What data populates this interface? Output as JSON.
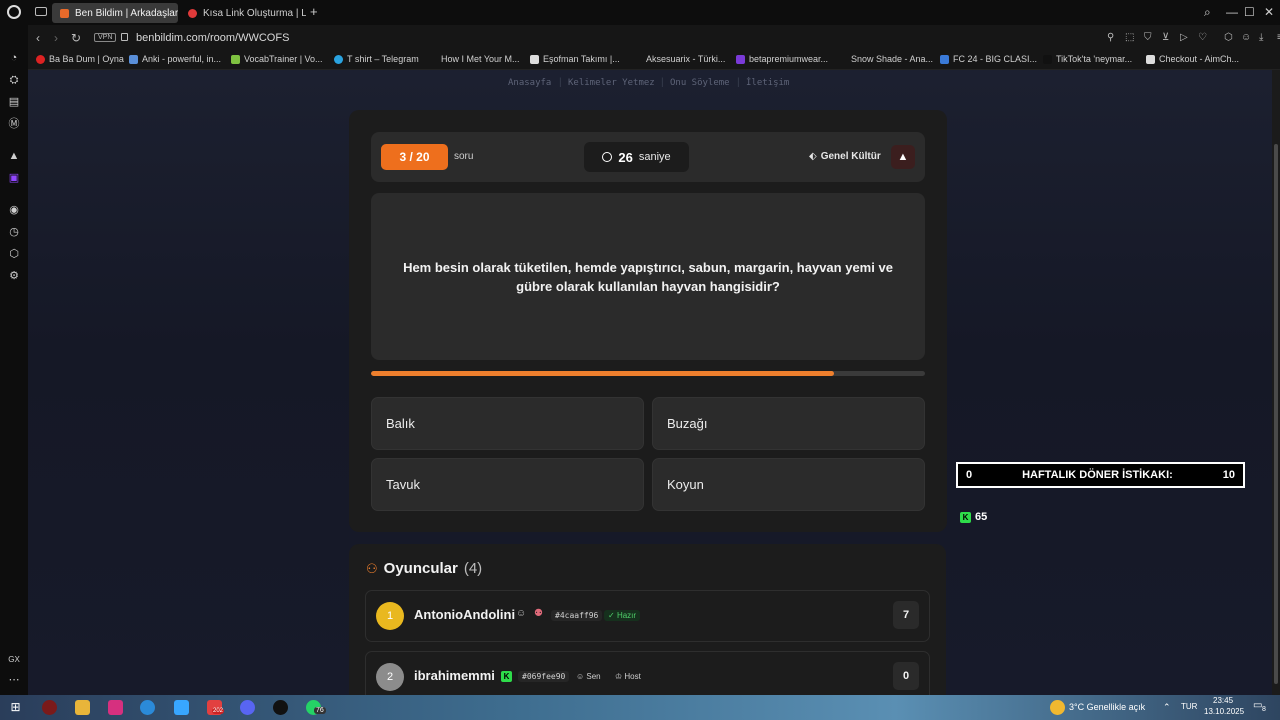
{
  "browser": {
    "tabs": [
      {
        "label": "Ben Bildim | Arkadaşların",
        "favicon_color": "#e86a2a",
        "active": true
      },
      {
        "label": "Kısa Link Oluşturma | Link",
        "favicon_color": "#e03a3a",
        "active": false
      }
    ],
    "new_tab": "+",
    "url": "benbildim.com/room/WWCOFS",
    "vpn_label": "VPN",
    "bookmarks": [
      {
        "label": "Ba Ba Dum | Oyna",
        "color": "#d22"
      },
      {
        "label": "Anki - powerful, in...",
        "color": "#5a8fd8"
      },
      {
        "label": "VocabTrainer | Vo...",
        "color": "#7fc241"
      },
      {
        "label": "T shirt – Telegram",
        "color": "#2aa3e0"
      },
      {
        "label": "How I Met Your M...",
        "color": "#222"
      },
      {
        "label": "Eşofman Takımı |...",
        "color": "#ddd"
      },
      {
        "label": "Aksesuarix - Türki...",
        "color": "#222"
      },
      {
        "label": "betapremiumwear...",
        "color": "#7a3ad8"
      },
      {
        "label": "Snow Shade - Ana...",
        "color": "#222"
      },
      {
        "label": "FC 24 - BIG CLASI...",
        "color": "#3a7ad8"
      },
      {
        "label": "TikTok'ta 'neymar...",
        "color": "#111"
      },
      {
        "label": "Checkout - AimCh...",
        "color": "#ddd"
      }
    ]
  },
  "site_nav": [
    "Anasayfa",
    "Kelimeler Yetmez",
    "Onu Söyleme",
    "İletişim"
  ],
  "question": {
    "counter": "3 / 20",
    "counter_word": "soru",
    "seconds": "26",
    "seconds_label": "saniye",
    "category": "Genel Kültür",
    "warn_icon": "▲",
    "text": "Hem besin olarak tüketilen, hemde yapıştırıcı, sabun, margarin, hayvan yemi ve gübre olarak kullanılan hayvan hangisidir?",
    "progress": 0.835,
    "progress_color": "#ee7f2d",
    "answers": [
      "Balık",
      "Buzağı",
      "Tavuk",
      "Koyun"
    ]
  },
  "players": {
    "title": "Oyuncular",
    "count": "(4)",
    "list": [
      {
        "rank": "1",
        "name": "AntonioAndolini",
        "tag": "#4caaff96",
        "badge": "Hazır",
        "score": "7",
        "rank_color": "#e9b81f"
      },
      {
        "rank": "2",
        "name": "ibrahimemmi",
        "tag": "#069fee90",
        "badge_you": "Sen",
        "badge_host": "Host",
        "score": "0",
        "rank_color": "#8c8c8c"
      }
    ]
  },
  "overlay": {
    "weekly_left": "0",
    "weekly_label": "HAFTALIK DÖNER İSTİKAKI:",
    "weekly_right": "10",
    "kick_count": "65"
  },
  "taskbar": {
    "weather": "3°C  Genellikle açık",
    "lang": "TUR",
    "time": "23:45",
    "date": "13.10.2025",
    "notif": "8",
    "badge_76": "76",
    "badge_202": "202"
  }
}
